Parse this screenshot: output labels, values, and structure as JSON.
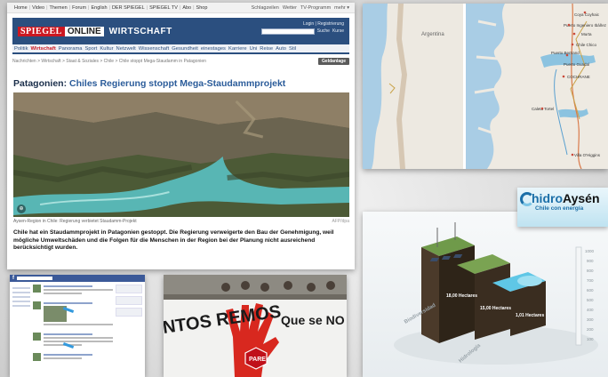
{
  "spiegel": {
    "top_nav": [
      "Home",
      "Video",
      "Themen",
      "Forum",
      "English",
      "DER SPIEGEL",
      "SPIEGEL TV",
      "Abo",
      "Shop"
    ],
    "top_nav_right": [
      "Schlagzeilen",
      "Wetter",
      "TV-Programm",
      "mehr ▾"
    ],
    "logo_spiegel": "SPIEGEL",
    "logo_online": "ONLINE",
    "section": "WIRTSCHAFT",
    "login": "Login | Registrierung",
    "search_options": [
      "Suche",
      "Kurse"
    ],
    "section_nav": [
      "Politik",
      "Wirtschaft",
      "Panorama",
      "Sport",
      "Kultur",
      "Netzwelt",
      "Wissenschaft",
      "Gesundheit",
      "einestages",
      "Karriere",
      "Uni",
      "Reise",
      "Auto",
      "Stil"
    ],
    "active_section": "Wirtschaft",
    "breadcrumb": "Nachrichten > Wirtschaft > Staat & Soziales > Chile > Chile stoppt Mega-Staudamm in Patagonien",
    "geldanlage_button": "Geldanlage",
    "headline_kicker": "Patagonien:",
    "headline_main": "Chiles Regierung stoppt Mega-Staudammprojekt",
    "caption": "Aysen-Region in Chile: Regierung verbietet Staudamm-Projekt",
    "credit": "AFP/dpa",
    "teaser": "Chile hat ein Staudammprojekt in Patagonien gestoppt. Die Regierung verweigerte den Bau der Genehmigung, weil mögliche Umweltschäden und die Folgen für die Menschen in der Region bei der Planung nicht ausreichend berücksichtigt wurden."
  },
  "map": {
    "labels": [
      "Argentina",
      "Coya Coyhaic",
      "Puerto Ingeniero Ibáñez",
      "Murta",
      "Chile Chico",
      "Puerto Bertrand",
      "Puerto Guadal",
      "COCHRANE",
      "Caleta Tortel",
      "Villa O'Higgins"
    ]
  },
  "hidroaysen": {
    "brand_first": "hidro",
    "brand_second": "Aysén",
    "slogan": "Chile con energía",
    "scale_ticks": [
      "1000",
      "900",
      "800",
      "700",
      "600",
      "500",
      "400",
      "300",
      "200",
      "100"
    ],
    "block_areas": [
      "18,00 Hectares",
      "15,00 Hectares",
      "1,01 Hectares"
    ],
    "axis_words": [
      "Biodiversidad",
      "Hidrología"
    ]
  },
  "protest": {
    "banner_left": "NTOS REMOS",
    "banner_right": "Que se NO A EN",
    "stop_sign": "PARE"
  },
  "colors": {
    "spiegel_red": "#cc1821",
    "spiegel_blue": "#2b4f7f",
    "headline_blue": "#2b5c9a",
    "facebook_blue": "#3b5998",
    "hidro_blue": "#1c6fa8"
  }
}
